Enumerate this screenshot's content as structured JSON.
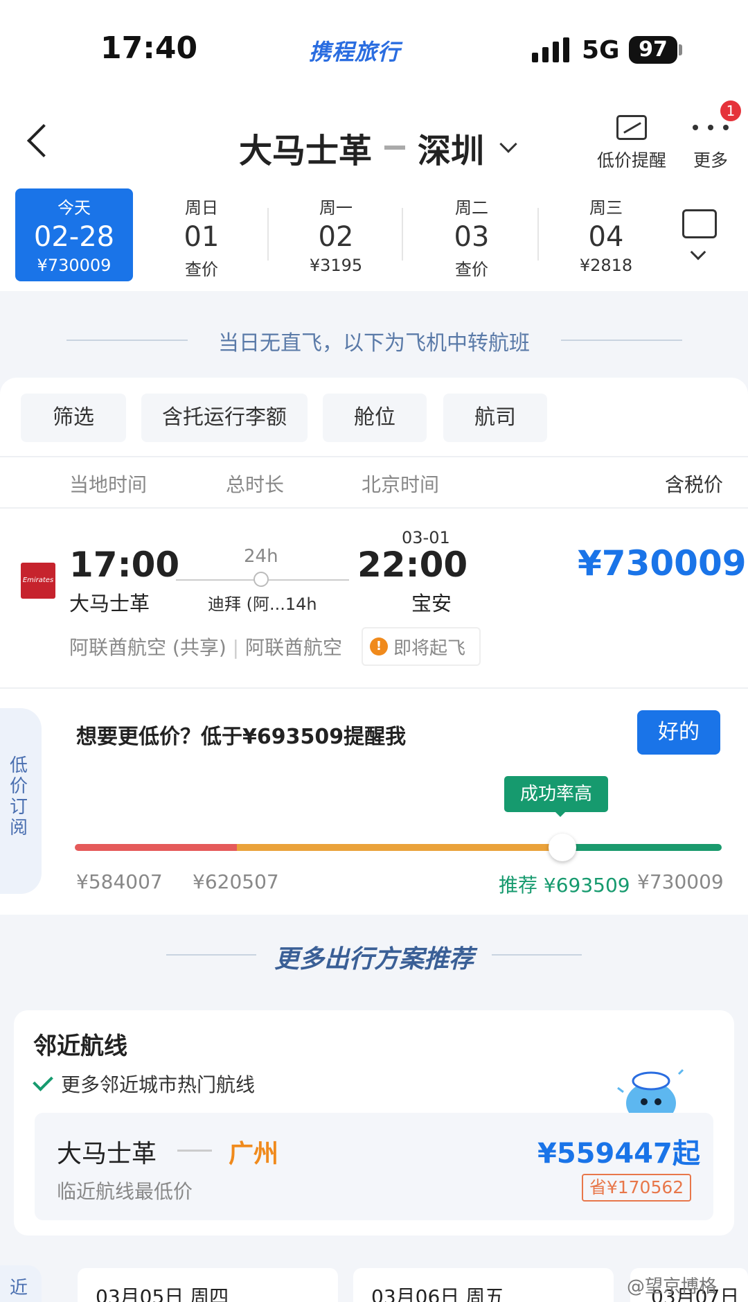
{
  "status": {
    "time": "17:40",
    "app_logo": "携程旅行",
    "network": "5G",
    "battery": "97"
  },
  "header": {
    "origin": "大马士革",
    "destination": "深圳",
    "price_alert_label": "低价提醒",
    "more_label": "更多",
    "badge_count": "1"
  },
  "dates": [
    {
      "weekday": "今天",
      "date": "02-28",
      "price": "¥730009",
      "active": true
    },
    {
      "weekday": "周日",
      "date": "01",
      "price": "查价"
    },
    {
      "weekday": "周一",
      "date": "02",
      "price": "¥3195"
    },
    {
      "weekday": "周二",
      "date": "03",
      "price": "查价"
    },
    {
      "weekday": "周三",
      "date": "04",
      "price": "¥2818"
    }
  ],
  "notice": "当日无直飞，以下为飞机中转航班",
  "filters": {
    "filter": "筛选",
    "baggage": "含托运行李额",
    "cabin": "舱位",
    "airline": "航司"
  },
  "columns": {
    "local_time": "当地时间",
    "duration": "总时长",
    "beijing_time": "北京时间",
    "tax_price": "含税价"
  },
  "flight": {
    "dep_time": "17:00",
    "dep_city": "大马士革",
    "duration": "24h",
    "stopover": "迪拜 (阿...14h",
    "arr_date": "03-01",
    "arr_time": "22:00",
    "arr_city": "宝安",
    "price": "¥730009",
    "airline_shared": "阿联酋航空 (共享)",
    "airline": "阿联酋航空",
    "warning": "即将起飞",
    "logo_text": "Emirates"
  },
  "subscription": {
    "tab_label": "低价订阅",
    "title": "想要更低价？低于¥693509提醒我",
    "ok": "好的",
    "tooltip": "成功率高",
    "level": 0.83,
    "ticks": [
      "¥584007",
      "¥620507",
      "推荐 ¥693509",
      "¥730009"
    ]
  },
  "more_title": "更多出行方案推荐",
  "nearby": {
    "title": "邻近航线",
    "subtitle": "更多邻近城市热门航线",
    "from": "大马士革",
    "to": "广州",
    "low_label": "临近航线最低价",
    "price": "¥559447起",
    "save": "省¥170562"
  },
  "bottom": {
    "tab": "近",
    "dates": [
      "03月05日 周四",
      "03月06日 周五",
      "03月07日"
    ]
  },
  "watermark": "@望京博格",
  "colors": {
    "primary": "#1a74e8",
    "green": "#169a6e",
    "orange": "#f08a1c",
    "red": "#e55a5a"
  }
}
